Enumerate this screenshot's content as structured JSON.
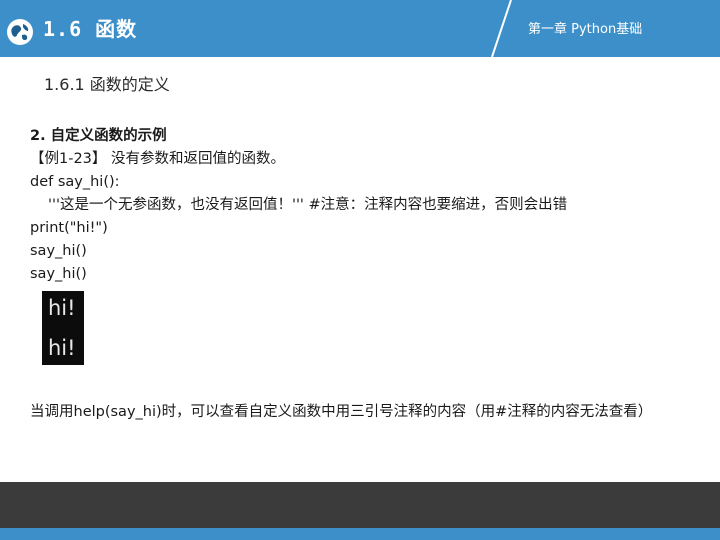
{
  "header": {
    "section_title": "1.6  函数",
    "chapter": "第一章 Python基础",
    "globe_icon": "globe-icon",
    "accent_color": "#3d8fc9"
  },
  "subsection": {
    "title": "1.6.1  函数的定义"
  },
  "content": {
    "heading": "2. 自定义函数的示例",
    "example_label": "【例1-23】 没有参数和返回值的函数。",
    "code": [
      "def say_hi():",
      "'''这是一个无参函数，也没有返回值！''' #注意：注释内容也要缩进，否则会出错",
      "print(\"hi!\")",
      "say_hi()",
      "say_hi()"
    ]
  },
  "output": {
    "lines": [
      "hi!",
      "hi!"
    ]
  },
  "note": {
    "text": "当调用help(say_hi)时，可以查看自定义函数中用三引号注释的内容（用#注释的内容无法查看）"
  },
  "footer": {
    "dark_color": "#3b3b3b"
  }
}
